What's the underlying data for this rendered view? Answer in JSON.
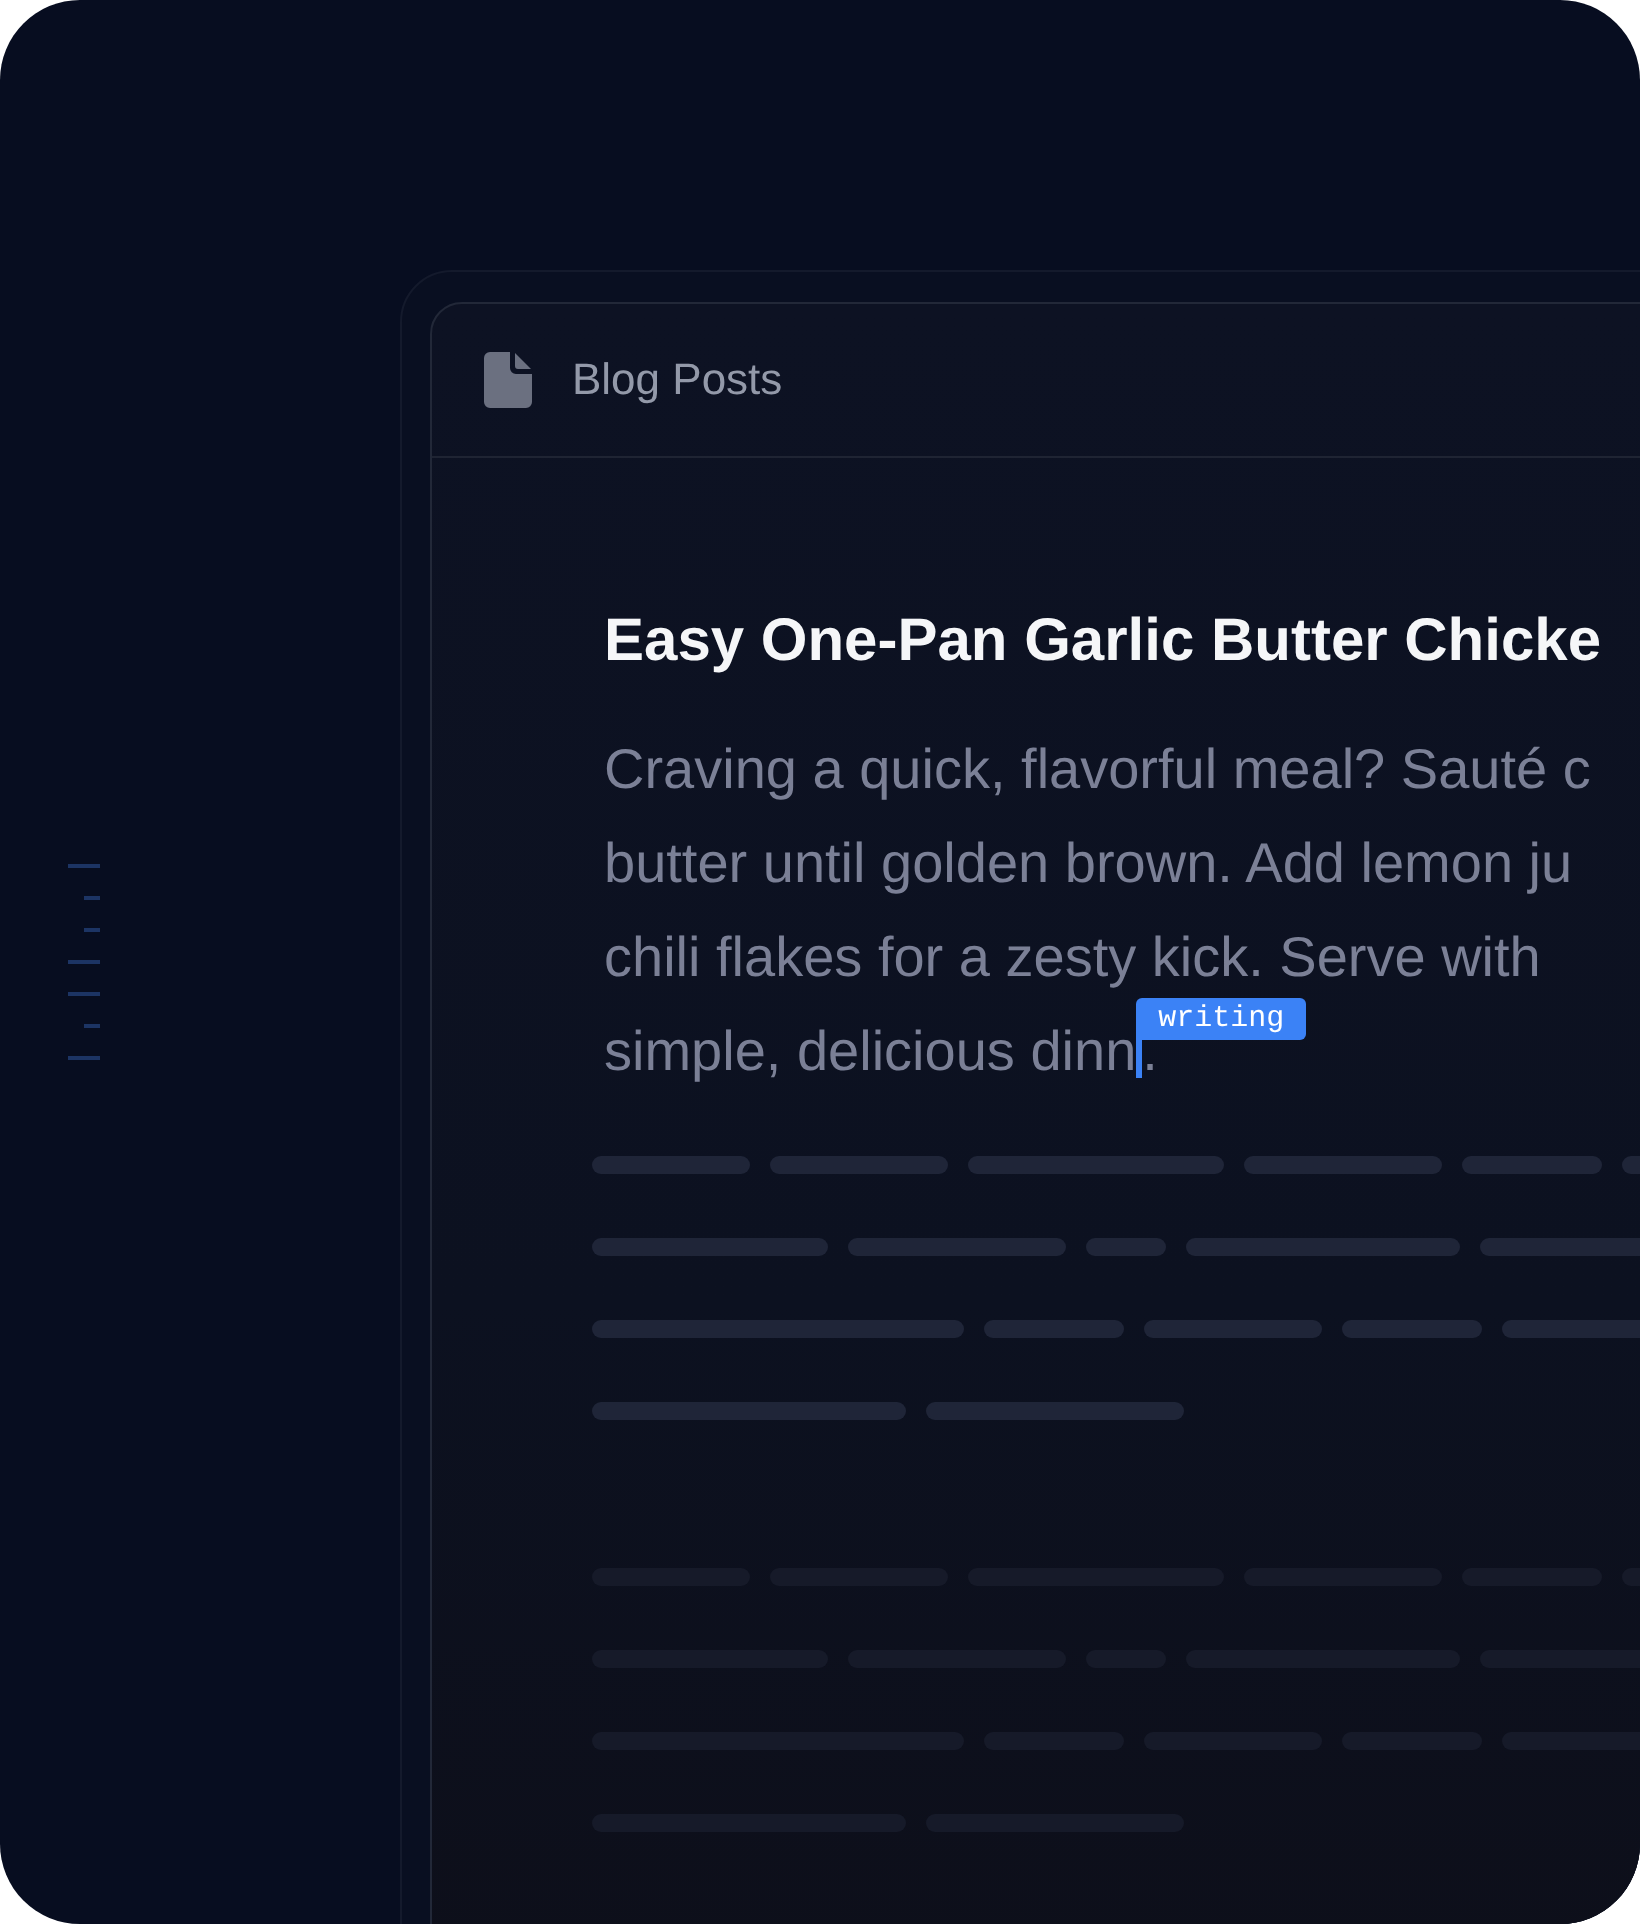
{
  "document_tab": {
    "title": "Blog Posts"
  },
  "post": {
    "title": "Easy One-Pan Garlic Butter Chicke",
    "lines": [
      "Craving a quick, flavorful meal? Sauté c",
      "butter until golden brown. Add lemon ju",
      "chili flakes for a zesty kick. Serve with",
      "simple, delicious dinn"
    ],
    "cursor": {
      "label": "writing",
      "after": "."
    }
  }
}
